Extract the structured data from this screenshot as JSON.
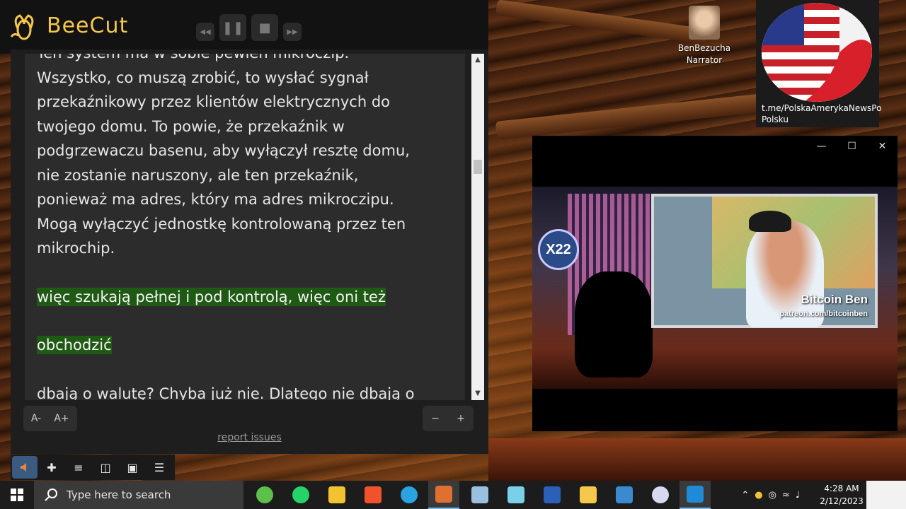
{
  "app": {
    "name": "BeeCut",
    "controls": [
      "rewind",
      "pause",
      "stop",
      "forward"
    ]
  },
  "reader": {
    "lines_top": [
      "Ten system ma w sobie pewien mikroczip.",
      "Wszystko, co muszą zrobić, to wysłać sygnał",
      "przekaźnikowy przez klientów elektrycznych do",
      "twojego domu. To powie, że przekaźnik w",
      "podgrzewaczu basenu, aby wyłączył resztę domu,",
      "nie zostanie naruszony, ale ten przekaźnik,",
      "ponieważ ma adres, który ma adres mikroczipu.",
      "Mogą wyłączyć jednostkę kontrolowaną przez ten",
      "mikrochip."
    ],
    "highlight_1": "więc szukają pełnej i pod kontrolą, więc oni też",
    "highlight_2": "obchodzić",
    "line_bottom": "dbają o walutę? Chyba już nie. Dlatego nie dbają o",
    "font_decrease": "A-",
    "font_increase": "A+",
    "minus": "−",
    "plus": "+",
    "report_link": "report issues"
  },
  "toolbar": {
    "items": [
      "speaker-icon",
      "puzzle-icon",
      "list-icon",
      "sidebar-icon",
      "wallet-icon",
      "menu-icon"
    ]
  },
  "desktop": {
    "narrator_label_1": "BenBezucha",
    "narrator_label_2": "Narrator",
    "flag_caption_1": "t.me/PolskaAmerykaNewsPo",
    "flag_caption_2": "Polsku"
  },
  "video": {
    "logo": "X22",
    "host_name": "Bitcoin Ben",
    "host_url": "patreon.com/bitcoinben"
  },
  "taskbar": {
    "search_placeholder": "Type here to search",
    "time": "4:28 AM",
    "date": "2/12/2023"
  },
  "colors": {
    "highlight": "#1f5a14",
    "beecut_yellow": "#f5c84b",
    "taskbar": "#1c1c1c"
  }
}
